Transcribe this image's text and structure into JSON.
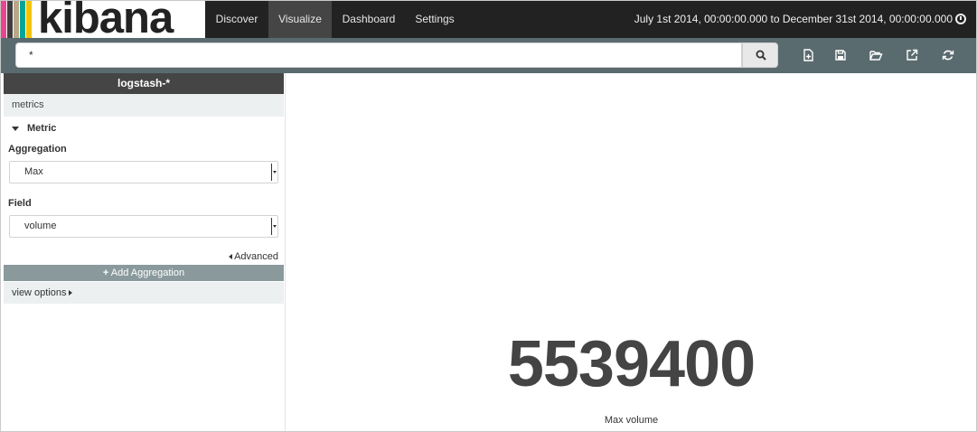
{
  "app": {
    "logo_text": "kibana",
    "stripe_colors": [
      "#e8488b",
      "#3f3f3f",
      "#b9a888",
      "#00a69b",
      "#f3c300"
    ]
  },
  "nav": {
    "items": [
      "Discover",
      "Visualize",
      "Dashboard",
      "Settings"
    ],
    "active": "Visualize"
  },
  "timerange": {
    "text": "July 1st 2014, 00:00:00.000 to December 31st 2014, 00:00:00.000"
  },
  "search": {
    "query": "*"
  },
  "toolbar": {
    "icons": [
      "new-visualization-icon",
      "save-icon",
      "open-icon",
      "share-icon",
      "refresh-icon"
    ]
  },
  "sidebar": {
    "index_pattern": "logstash-*",
    "metrics_label": "metrics",
    "metric_label": "Metric",
    "aggregation_label": "Aggregation",
    "aggregation_value": "Max",
    "field_label": "Field",
    "field_value": "volume",
    "advanced_label": "Advanced",
    "add_aggregation_label": "Add Aggregation",
    "view_options_label": "view options"
  },
  "visualization": {
    "value": "5539400",
    "label": "Max volume"
  },
  "colors": {
    "topbar": "#222222",
    "searchrow": "#5a6b6f",
    "add_button": "#8a9a9c",
    "accent_panel": "#ecf0f1"
  }
}
